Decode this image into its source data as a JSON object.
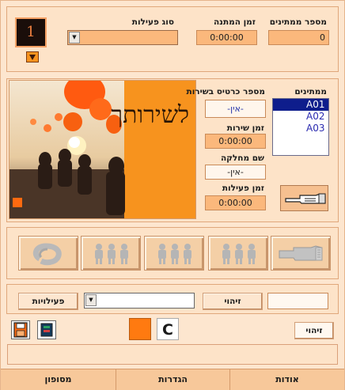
{
  "header": {
    "counter_value": "1",
    "waiting_count_label": "מספר ממתינים",
    "waiting_count_value": "0",
    "wait_time_label": "זמן המתנה",
    "wait_time_value": "0:00:00",
    "activity_type_label": "סוג פעילות",
    "activity_type_value": ""
  },
  "service": {
    "waiting_list_label": "ממתינים",
    "waiting_list": [
      "A01",
      "A02",
      "A03"
    ],
    "selected_index": 0,
    "ticket_label": "מספר כרטיס בשירות",
    "ticket_value": "-אין-",
    "service_time_label": "זמן שירות",
    "service_time_value": "0:00:00",
    "department_label": "שם מחלקה",
    "department_value": "-אין-",
    "activity_time_label": "זמן פעילות",
    "activity_time_value": "0:00:00",
    "photo_slogan": "לשירותך"
  },
  "actions": {
    "buttons": [
      {
        "name": "call-next-button",
        "icon": "hand-icon"
      },
      {
        "name": "group-3-button-a",
        "icon": "people-group-icon"
      },
      {
        "name": "group-3-button-b",
        "icon": "people-group-icon"
      },
      {
        "name": "group-3-button-c",
        "icon": "people-group-icon"
      },
      {
        "name": "recall-button",
        "icon": "refresh-circle-icon"
      }
    ]
  },
  "activity_row": {
    "input_value": "",
    "identify_label": "זיהוי",
    "combo_value": "",
    "activities_label": "פעילויות"
  },
  "status_row": {
    "identify_button_label": "זיהוי",
    "c_label": "C",
    "orange_swatch_color": "#ff7a10",
    "status_text": ""
  },
  "tabs": [
    "אודות",
    "הגדרות",
    "מסופון"
  ],
  "colors": {
    "panel_bg": "#fde3c8",
    "field_bg": "#fbb87c",
    "accent": "#f7931e",
    "list_selection": "#0e1d8c"
  }
}
